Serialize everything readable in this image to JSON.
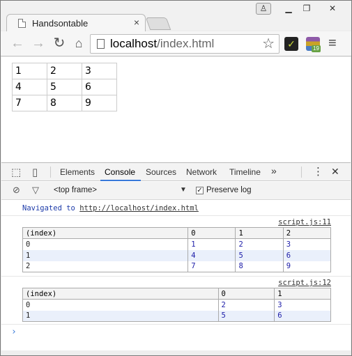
{
  "browser": {
    "tab_title": "Handsontable",
    "tab_close": "×",
    "url_host": "localhost",
    "url_path": "/index.html",
    "window_buttons": {
      "min": "▭",
      "max": "▢",
      "close": "✕"
    }
  },
  "page": {
    "grid": [
      [
        "1",
        "2",
        "3"
      ],
      [
        "4",
        "5",
        "6"
      ],
      [
        "7",
        "8",
        "9"
      ]
    ]
  },
  "devtools": {
    "tabs": [
      "Elements",
      "Console",
      "Sources",
      "Network",
      "Timeline"
    ],
    "active_tab": "Console",
    "more": "»",
    "kebab": "⋮",
    "close": "✕",
    "frame_selector": "<top frame>",
    "preserve_log": "Preserve log",
    "preserve_log_checked": true,
    "nav_prefix": "Navigated to",
    "nav_url": "http://localhost/index.html",
    "tables": [
      {
        "source": "script.js:11",
        "headers": [
          "(index)",
          "0",
          "1",
          "2"
        ],
        "rows": [
          [
            "0",
            "1",
            "2",
            "3"
          ],
          [
            "1",
            "4",
            "5",
            "6"
          ],
          [
            "2",
            "7",
            "8",
            "9"
          ]
        ]
      },
      {
        "source": "script.js:12",
        "headers": [
          "(index)",
          "0",
          "1"
        ],
        "rows": [
          [
            "0",
            "2",
            "3"
          ],
          [
            "1",
            "5",
            "6"
          ]
        ]
      }
    ],
    "prompt": "›"
  }
}
